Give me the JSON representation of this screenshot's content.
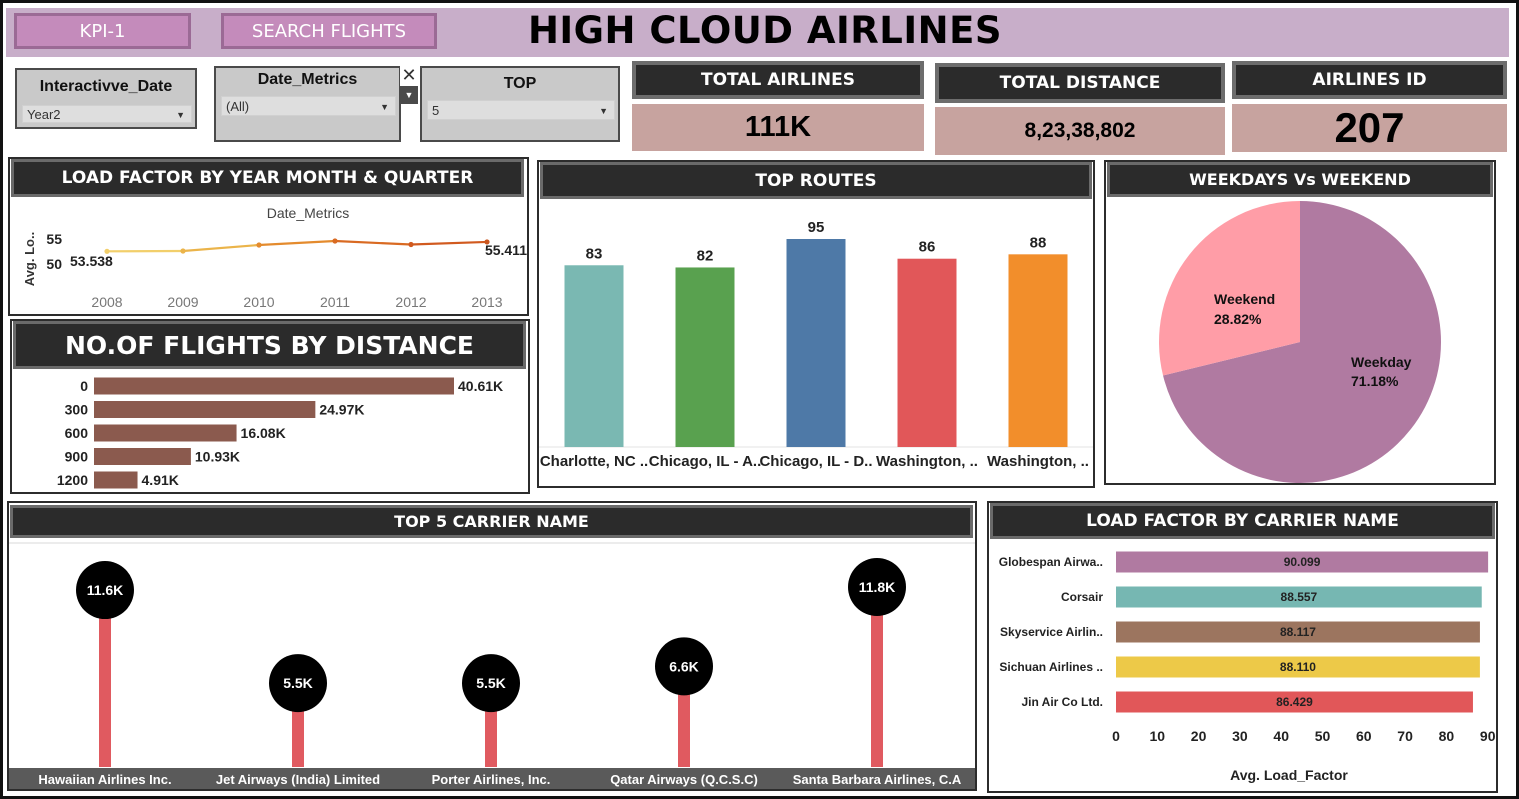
{
  "header": {
    "title": "HIGH CLOUD AIRLINES",
    "kpi_button": "KPI-1",
    "search_button": "SEARCH FLIGHTS"
  },
  "filters": {
    "interactive_date": {
      "label": "Interactivve_Date",
      "value": "Year2"
    },
    "date_metrics": {
      "label": "Date_Metrics",
      "value": "(All)",
      "close": "✕",
      "dropdown": "▼"
    },
    "top": {
      "label": "TOP",
      "value": "5"
    }
  },
  "kpis": {
    "total_airlines": {
      "label": "TOTAL AIRLINES",
      "value": "111K"
    },
    "total_distance": {
      "label": "TOTAL DISTANCE",
      "value": "8,23,38,802"
    },
    "airlines_id": {
      "label": "AIRLINES ID",
      "value": "207"
    }
  },
  "colors": {
    "brown_bar": "#8b5a4e",
    "lollipop": "#e05a60",
    "kpi_value_bg": "#c7a39f",
    "header_bg": "#c8aec9"
  },
  "chart_data": [
    {
      "id": "load_factor_year",
      "type": "line",
      "panel_title": "LOAD FACTOR  BY YEAR MONTH & QUARTER",
      "title": "Date_Metrics",
      "ylabel": "Avg. Lo..",
      "x": [
        "2008",
        "2009",
        "2010",
        "2011",
        "2012",
        "2013"
      ],
      "values": [
        53.538,
        53.6,
        54.8,
        55.6,
        54.9,
        55.411
      ],
      "data_labels": [
        "53.538",
        "",
        "",
        "",
        "",
        "55.411"
      ],
      "yticks": [
        "55",
        "50"
      ],
      "ylim": [
        47,
        58
      ]
    },
    {
      "id": "flights_by_distance",
      "type": "bar",
      "orientation": "horizontal",
      "panel_title": "NO.OF FLIGHTS BY DISTANCE",
      "categories": [
        "0",
        "300",
        "600",
        "900",
        "1200"
      ],
      "values": [
        40610,
        24970,
        16080,
        10930,
        4910
      ],
      "labels": [
        "40.61K",
        "24.97K",
        "16.08K",
        "10.93K",
        "4.91K"
      ]
    },
    {
      "id": "top_routes",
      "type": "bar",
      "panel_title": "TOP ROUTES",
      "categories": [
        "Charlotte, NC ..",
        "Chicago, IL - A..",
        "Chicago, IL - D..",
        "Washington, ..",
        "Washington, .."
      ],
      "values": [
        83,
        82,
        95,
        86,
        88
      ],
      "colors": [
        "#7ab8b2",
        "#59a14f",
        "#4e79a7",
        "#e15759",
        "#f28e2b"
      ],
      "ylim": [
        0,
        100
      ]
    },
    {
      "id": "weekdays_weekend",
      "type": "pie",
      "panel_title": "WEEKDAYS Vs WEEKEND",
      "categories": [
        "Weekday",
        "Weekend"
      ],
      "values": [
        71.18,
        28.82
      ],
      "labels": [
        "71.18%",
        "28.82%"
      ],
      "colors": [
        "#b07aa1",
        "#ff9da7"
      ]
    },
    {
      "id": "top5_carrier",
      "type": "bar",
      "style": "lollipop",
      "panel_title": "TOP 5 CARRIER NAME",
      "categories": [
        "Hawaiian Airlines Inc.",
        "Jet Airways (India) Limited",
        "Porter Airlines, Inc.",
        "Qatar Airways (Q.C.S.C)",
        "Santa Barbara Airlines, C.A"
      ],
      "values": [
        11.6,
        5.5,
        5.5,
        6.6,
        11.8
      ],
      "labels": [
        "11.6K",
        "5.5K",
        "5.5K",
        "6.6K",
        "11.8K"
      ],
      "ylim": [
        0,
        14
      ]
    },
    {
      "id": "load_factor_carrier",
      "type": "bar",
      "orientation": "horizontal",
      "panel_title": "LOAD FACTOR BY CARRIER NAME",
      "categories": [
        "Globespan Airwa..",
        "Corsair",
        "Skyservice Airlin..",
        "Sichuan Airlines ..",
        "Jin Air Co Ltd."
      ],
      "values": [
        90.099,
        88.557,
        88.117,
        88.11,
        86.429
      ],
      "labels": [
        "90.099",
        "88.557",
        "88.117",
        "88.110",
        "86.429"
      ],
      "colors": [
        "#b07aa1",
        "#76b7b2",
        "#9c755f",
        "#edc948",
        "#e15759"
      ],
      "xticks": [
        "0",
        "10",
        "20",
        "30",
        "40",
        "50",
        "60",
        "70",
        "80",
        "90"
      ],
      "xlim": [
        0,
        92
      ],
      "xlabel": "Avg. Load_Factor"
    }
  ]
}
